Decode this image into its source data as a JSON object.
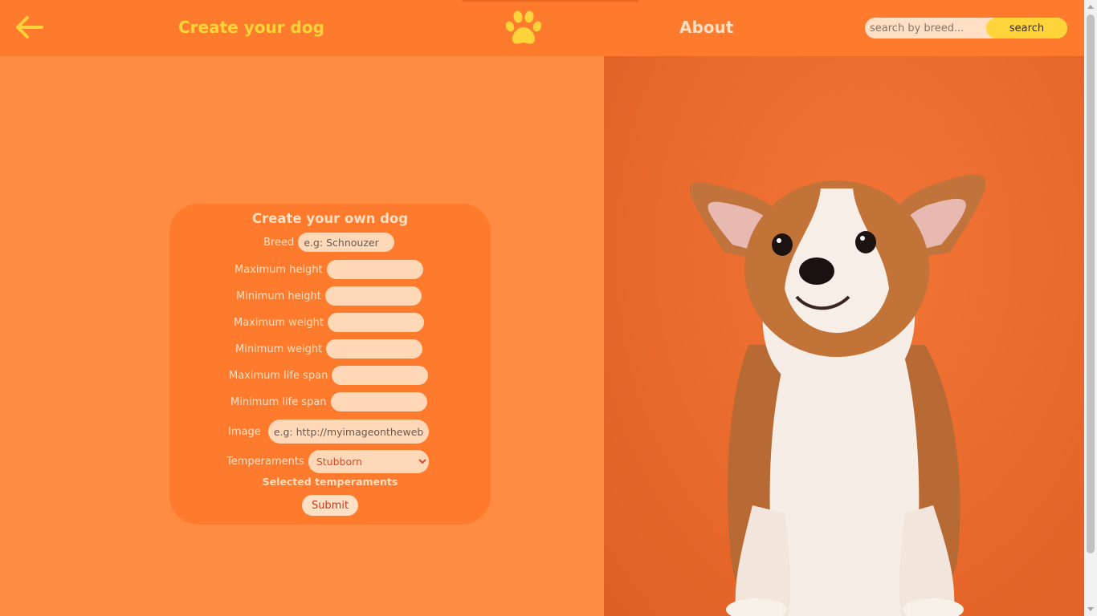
{
  "header": {
    "back_icon": "arrow-left-icon",
    "create_link": "Create your dog",
    "logo_icon": "paw-icon",
    "about_link": "About",
    "search_placeholder": "search by breed...",
    "search_button": "search"
  },
  "form": {
    "title": "Create your own dog",
    "breed": {
      "label": "Breed",
      "placeholder": "e.g: Schnouzer",
      "value": ""
    },
    "max_height": {
      "label": "Maximum height",
      "value": ""
    },
    "min_height": {
      "label": "Minimum height",
      "value": ""
    },
    "max_weight": {
      "label": "Maximum weight",
      "value": ""
    },
    "min_weight": {
      "label": "Minimum weight",
      "value": ""
    },
    "max_life_span": {
      "label": "Maximum life span",
      "value": ""
    },
    "min_life_span": {
      "label": "Minimum life span",
      "value": ""
    },
    "image": {
      "label": "Image",
      "placeholder": "e.g: http://myimageontheweb.com",
      "value": ""
    },
    "temperaments": {
      "label": "Temperaments",
      "selected": "Stubborn"
    },
    "selected_temperaments_title": "Selected temperaments",
    "submit": "Submit"
  },
  "colors": {
    "header_bg": "#fe7a2c",
    "page_bg": "#ff8c42",
    "accent_yellow": "#ffd43b",
    "light_cream": "#ffe0c4",
    "input_bg": "#ffd8b8",
    "photo_bg": "#e96a2d"
  }
}
